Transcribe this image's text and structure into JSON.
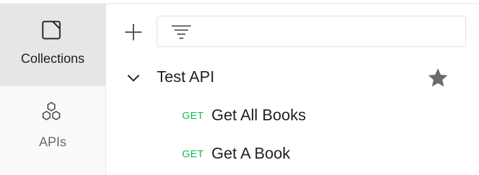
{
  "sidebar": {
    "items": [
      {
        "label": "Collections",
        "icon": "collections-icon",
        "active": true
      },
      {
        "label": "APIs",
        "icon": "apis-icon",
        "active": false
      }
    ]
  },
  "toolbar": {
    "add_icon": "plus-icon",
    "filter_icon": "filter-icon",
    "filter_placeholder": "",
    "filter_value": ""
  },
  "tree": {
    "collection": {
      "name": "Test API",
      "expanded": true,
      "starred": true
    },
    "requests": [
      {
        "method": "GET",
        "name": "Get All Books"
      },
      {
        "method": "GET",
        "name": "Get A Book"
      }
    ]
  },
  "colors": {
    "get_method": "#0cbb52",
    "active_sidebar": "#e6e6e6",
    "star": "#6b6b6b"
  }
}
